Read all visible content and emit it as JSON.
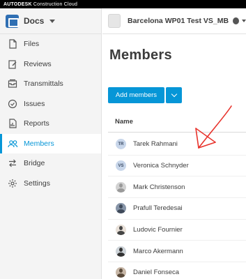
{
  "brand": {
    "bold": "AUTODESK",
    "light": "Construction Cloud"
  },
  "module": {
    "label": "Docs"
  },
  "project": {
    "name": "Barcelona WP01 Test VS_MB"
  },
  "sidebar": {
    "items": [
      {
        "label": "Files",
        "icon": "file-icon"
      },
      {
        "label": "Reviews",
        "icon": "review-icon"
      },
      {
        "label": "Transmittals",
        "icon": "transmittal-icon"
      },
      {
        "label": "Issues",
        "icon": "issue-icon"
      },
      {
        "label": "Reports",
        "icon": "report-icon"
      },
      {
        "label": "Members",
        "icon": "members-icon",
        "active": true
      },
      {
        "label": "Bridge",
        "icon": "bridge-icon"
      },
      {
        "label": "Settings",
        "icon": "settings-icon"
      }
    ]
  },
  "main": {
    "title": "Members",
    "add_button": "Add members",
    "column_name": "Name",
    "members": [
      {
        "name": "Tarek Rahmani",
        "initials": "TR"
      },
      {
        "name": "Veronica Schnyder",
        "initials": "VS"
      },
      {
        "name": "Mark Christenson"
      },
      {
        "name": "Prafull Teredesai"
      },
      {
        "name": "Ludovic Fournier"
      },
      {
        "name": "Marco Akermann"
      },
      {
        "name": "Daniel Fonseca"
      }
    ]
  },
  "colors": {
    "accent": "#0696d7",
    "annotation": "#e8322b",
    "topbar": "#000000"
  }
}
